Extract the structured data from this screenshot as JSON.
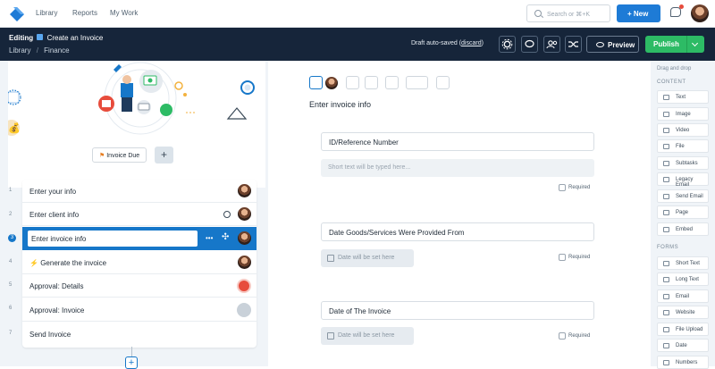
{
  "topnav": {
    "links": [
      "Library",
      "Reports",
      "My Work"
    ],
    "search_placeholder": "Search or ⌘+K",
    "new_button": "New"
  },
  "editor": {
    "editing_label": "Editing",
    "title": "Create an Invoice",
    "breadcrumb": [
      "Library",
      "Finance"
    ],
    "saved_text": "Draft auto-saved (",
    "discard_label": "discard",
    "saved_close": ")",
    "preview_button": "Preview",
    "publish_button": "Publish"
  },
  "left": {
    "due_label": "Invoice Due",
    "add_symbol": "+",
    "tasks": [
      {
        "num": "1",
        "label": "Enter your info"
      },
      {
        "num": "2",
        "label": "Enter client info"
      },
      {
        "num": "3",
        "label": "Enter invoice info"
      },
      {
        "num": "4",
        "label": "Generate the invoice",
        "prefix": "⚡"
      },
      {
        "num": "5",
        "label": "Approval: Details"
      },
      {
        "num": "6",
        "label": "Approval: Invoice"
      },
      {
        "num": "7",
        "label": "Send Invoice"
      }
    ],
    "add_task_symbol": "+"
  },
  "main": {
    "heading": "Enter invoice info",
    "fields": [
      {
        "label": "ID/Reference Number",
        "placeholder": "Short text will be typed here...",
        "required_label": "Required"
      },
      {
        "label": "Date Goods/Services Were Provided From",
        "placeholder": "Date will be set here",
        "required_label": "Required"
      },
      {
        "label": "Date of The Invoice",
        "placeholder": "Date will be set here",
        "required_label": "Required"
      }
    ]
  },
  "right": {
    "drag_hint": "Drag and drop",
    "content_heading": "CONTENT",
    "content_items": [
      "Text",
      "Image",
      "Video",
      "File",
      "Subtasks",
      "Legacy Email",
      "Send Email",
      "Page",
      "Embed"
    ],
    "forms_heading": "FORMS",
    "forms_items": [
      "Short Text",
      "Long Text",
      "Email",
      "Website",
      "File Upload",
      "Date",
      "Numbers"
    ]
  },
  "colors": {
    "accent": "#1677c9",
    "dark": "#16253a",
    "publish": "#2dbb65"
  }
}
